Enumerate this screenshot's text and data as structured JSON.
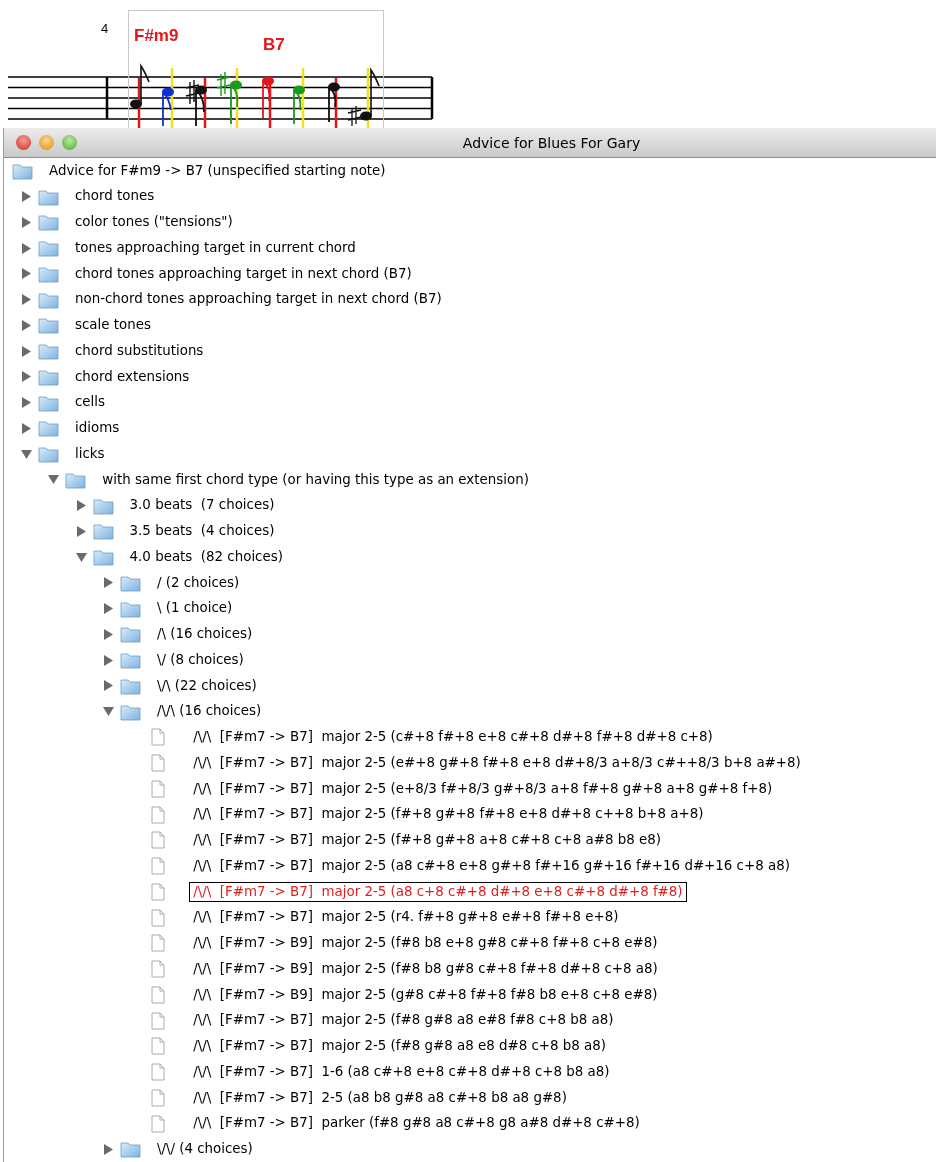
{
  "score": {
    "measure_number": "4",
    "chords": [
      {
        "name": "F#m9"
      },
      {
        "name": "B7"
      }
    ]
  },
  "window": {
    "title": "Advice for Blues For Gary"
  },
  "tree": {
    "label": "Advice for F#m9 -> B7 (unspecified starting note)",
    "kind": "folder",
    "children": [
      {
        "label": "chord tones",
        "kind": "folder",
        "expanded": false
      },
      {
        "label": "color tones (\"tensions\")",
        "kind": "folder",
        "expanded": false
      },
      {
        "label": "tones approaching target in current chord",
        "kind": "folder",
        "expanded": false
      },
      {
        "label": "chord tones approaching target in next chord (B7)",
        "kind": "folder",
        "expanded": false
      },
      {
        "label": "non-chord tones approaching target in next chord (B7)",
        "kind": "folder",
        "expanded": false
      },
      {
        "label": "scale tones",
        "kind": "folder",
        "expanded": false
      },
      {
        "label": "chord substitutions",
        "kind": "folder",
        "expanded": false
      },
      {
        "label": "chord extensions",
        "kind": "folder",
        "expanded": false
      },
      {
        "label": "cells",
        "kind": "folder",
        "expanded": false
      },
      {
        "label": "idioms",
        "kind": "folder",
        "expanded": false
      },
      {
        "label": "licks",
        "kind": "folder",
        "expanded": true,
        "children": [
          {
            "label": "with same first chord type (or having this type as an extension)",
            "kind": "folder",
            "expanded": true,
            "children": [
              {
                "label": "3.0 beats  (7 choices)",
                "kind": "folder",
                "expanded": false
              },
              {
                "label": "3.5 beats  (4 choices)",
                "kind": "folder",
                "expanded": false
              },
              {
                "label": "4.0 beats  (82 choices)",
                "kind": "folder",
                "expanded": true,
                "children": [
                  {
                    "label": "/ (2 choices)",
                    "kind": "folder",
                    "expanded": false
                  },
                  {
                    "label": "\\ (1 choice)",
                    "kind": "folder",
                    "expanded": false
                  },
                  {
                    "label": "/\\ (16 choices)",
                    "kind": "folder",
                    "expanded": false
                  },
                  {
                    "label": "\\/ (8 choices)",
                    "kind": "folder",
                    "expanded": false
                  },
                  {
                    "label": "\\/\\ (22 choices)",
                    "kind": "folder",
                    "expanded": false
                  },
                  {
                    "label": "/\\/\\ (16 choices)",
                    "kind": "folder",
                    "expanded": true,
                    "children": [
                      {
                        "label": "/\\/\\  [F#m7 -> B7]  major 2-5 (c#+8 f#+8 e+8 c#+8 d#+8 f#+8 d#+8 c+8)",
                        "kind": "file",
                        "selected": false
                      },
                      {
                        "label": "/\\/\\  [F#m7 -> B7]  major 2-5 (e#+8 g#+8 f#+8 e+8 d#+8/3 a+8/3 c#++8/3 b+8 a#+8)",
                        "kind": "file",
                        "selected": false
                      },
                      {
                        "label": "/\\/\\  [F#m7 -> B7]  major 2-5 (e+8/3 f#+8/3 g#+8/3 a+8 f#+8 g#+8 a+8 g#+8 f+8)",
                        "kind": "file",
                        "selected": false
                      },
                      {
                        "label": "/\\/\\  [F#m7 -> B7]  major 2-5 (f#+8 g#+8 f#+8 e+8 d#+8 c++8 b+8 a+8)",
                        "kind": "file",
                        "selected": false
                      },
                      {
                        "label": "/\\/\\  [F#m7 -> B7]  major 2-5 (f#+8 g#+8 a+8 c#+8 c+8 a#8 b8 e8)",
                        "kind": "file",
                        "selected": false
                      },
                      {
                        "label": "/\\/\\  [F#m7 -> B7]  major 2-5 (a8 c#+8 e+8 g#+8 f#+16 g#+16 f#+16 d#+16 c+8 a8)",
                        "kind": "file",
                        "selected": false
                      },
                      {
                        "label": "/\\/\\  [F#m7 -> B7]  major 2-5 (a8 c+8 c#+8 d#+8 e+8 c#+8 d#+8 f#8)",
                        "kind": "file",
                        "selected": true
                      },
                      {
                        "label": "/\\/\\  [F#m7 -> B7]  major 2-5 (r4. f#+8 g#+8 e#+8 f#+8 e+8)",
                        "kind": "file",
                        "selected": false
                      },
                      {
                        "label": "/\\/\\  [F#m7 -> B9]  major 2-5 (f#8 b8 e+8 g#8 c#+8 f#+8 c+8 e#8)",
                        "kind": "file",
                        "selected": false
                      },
                      {
                        "label": "/\\/\\  [F#m7 -> B9]  major 2-5 (f#8 b8 g#8 c#+8 f#+8 d#+8 c+8 a8)",
                        "kind": "file",
                        "selected": false
                      },
                      {
                        "label": "/\\/\\  [F#m7 -> B9]  major 2-5 (g#8 c#+8 f#+8 f#8 b8 e+8 c+8 e#8)",
                        "kind": "file",
                        "selected": false
                      },
                      {
                        "label": "/\\/\\  [F#m7 -> B7]  major 2-5 (f#8 g#8 a8 e#8 f#8 c+8 b8 a8)",
                        "kind": "file",
                        "selected": false
                      },
                      {
                        "label": "/\\/\\  [F#m7 -> B7]  major 2-5 (f#8 g#8 a8 e8 d#8 c+8 b8 a8)",
                        "kind": "file",
                        "selected": false
                      },
                      {
                        "label": "/\\/\\  [F#m7 -> B7]  1-6 (a8 c#+8 e+8 c#+8 d#+8 c+8 b8 a8)",
                        "kind": "file",
                        "selected": false
                      },
                      {
                        "label": "/\\/\\  [F#m7 -> B7]  2-5 (a8 b8 g#8 a8 c#+8 b8 a8 g#8)",
                        "kind": "file",
                        "selected": false
                      },
                      {
                        "label": "/\\/\\  [F#m7 -> B7]  parker (f#8 g#8 a8 c#+8 g8 a#8 d#+8 c#+8)",
                        "kind": "file",
                        "selected": false
                      }
                    ]
                  },
                  {
                    "label": "\\/\\/ (4 choices)",
                    "kind": "folder",
                    "expanded": false
                  }
                ]
              }
            ]
          }
        ]
      }
    ]
  }
}
